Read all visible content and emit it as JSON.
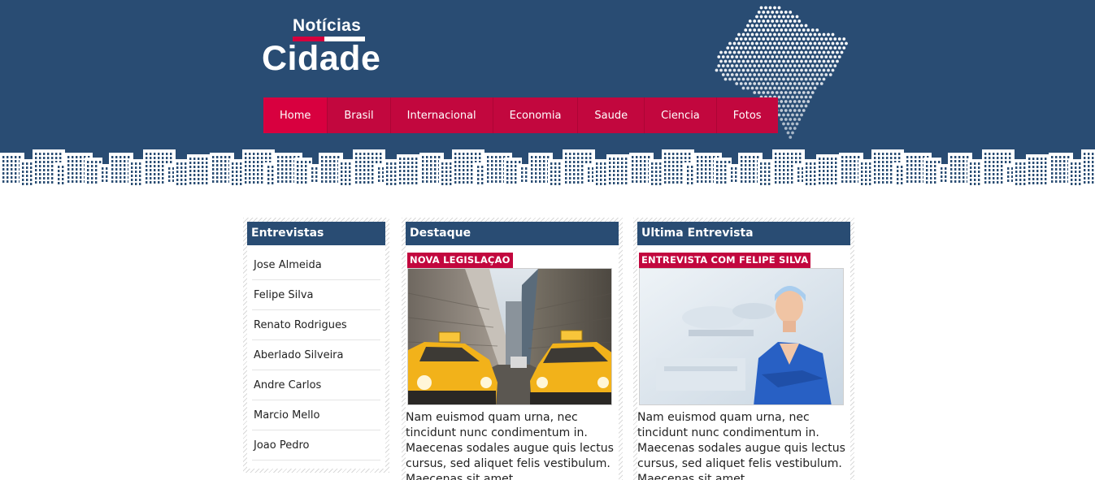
{
  "header": {
    "logo_top": "Notícias",
    "logo_main": "Cidade"
  },
  "nav": {
    "items": [
      {
        "label": "Home",
        "active": true
      },
      {
        "label": "Brasil"
      },
      {
        "label": "Internacional"
      },
      {
        "label": "Economia"
      },
      {
        "label": "Saude"
      },
      {
        "label": "Ciencia"
      },
      {
        "label": "Fotos"
      }
    ]
  },
  "entrevistas": {
    "title": "Entrevistas",
    "items": [
      "Jose Almeida",
      "Felipe Silva",
      "Renato Rodrigues",
      "Aberlado Silveira",
      "Andre Carlos",
      "Marcio Mello",
      "Joao Pedro"
    ]
  },
  "destaque": {
    "title": "Destaque",
    "tag": "NOVA LEGISLAÇAO",
    "text": "Nam euismod quam urna, nec tincidunt nunc condimentum in. Maecenas sodales augue quis lectus cursus, sed aliquet felis vestibulum. Maecenas sit amet"
  },
  "ultima": {
    "title": "Ultima Entrevista",
    "tag": "ENTREVISTA COM FELIPE SILVA",
    "text": "Nam euismod quam urna, nec tincidunt nunc condimentum in. Maecenas sodales augue quis lectus cursus, sed aliquet felis vestibulum. Maecenas sit amet"
  },
  "colors": {
    "header_blue": "#294c73",
    "accent_red": "#c2073e",
    "active_red": "#d8003f"
  }
}
